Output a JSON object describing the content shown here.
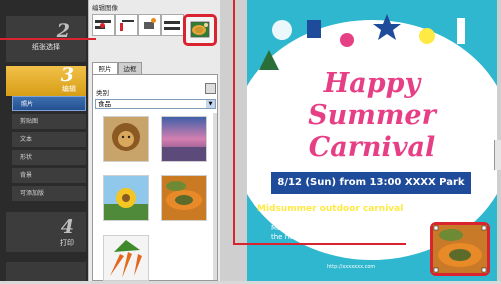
{
  "steps": [
    {
      "num": "2",
      "label": "纸张选择"
    },
    {
      "num": "3",
      "label": "编辑"
    },
    {
      "num": "4",
      "label": "打印"
    }
  ],
  "menu": [
    "照片",
    "剪贴图",
    "文本",
    "形状",
    "背景",
    "可添加版"
  ],
  "panel": {
    "title": "编辑图像",
    "tabs": [
      "照片",
      "边框"
    ],
    "category_label": "类别",
    "category_value": "食品"
  },
  "poster": {
    "title1": "Happy",
    "title2": "Summer",
    "title3": "Carnival",
    "ribbon": "8/12 (Sun) from 13:00  XXXX Park",
    "subtitle": "Midsummer outdoor carnival",
    "desc": "Many exciting events to help you get through the hot summer",
    "url": "http://xxxxxxx.com"
  },
  "colors": {
    "accent_red": "#d9232f",
    "poster_blue": "#2fb7d0",
    "title_pink": "#e73f86",
    "ribbon_navy": "#1f4c9a"
  }
}
